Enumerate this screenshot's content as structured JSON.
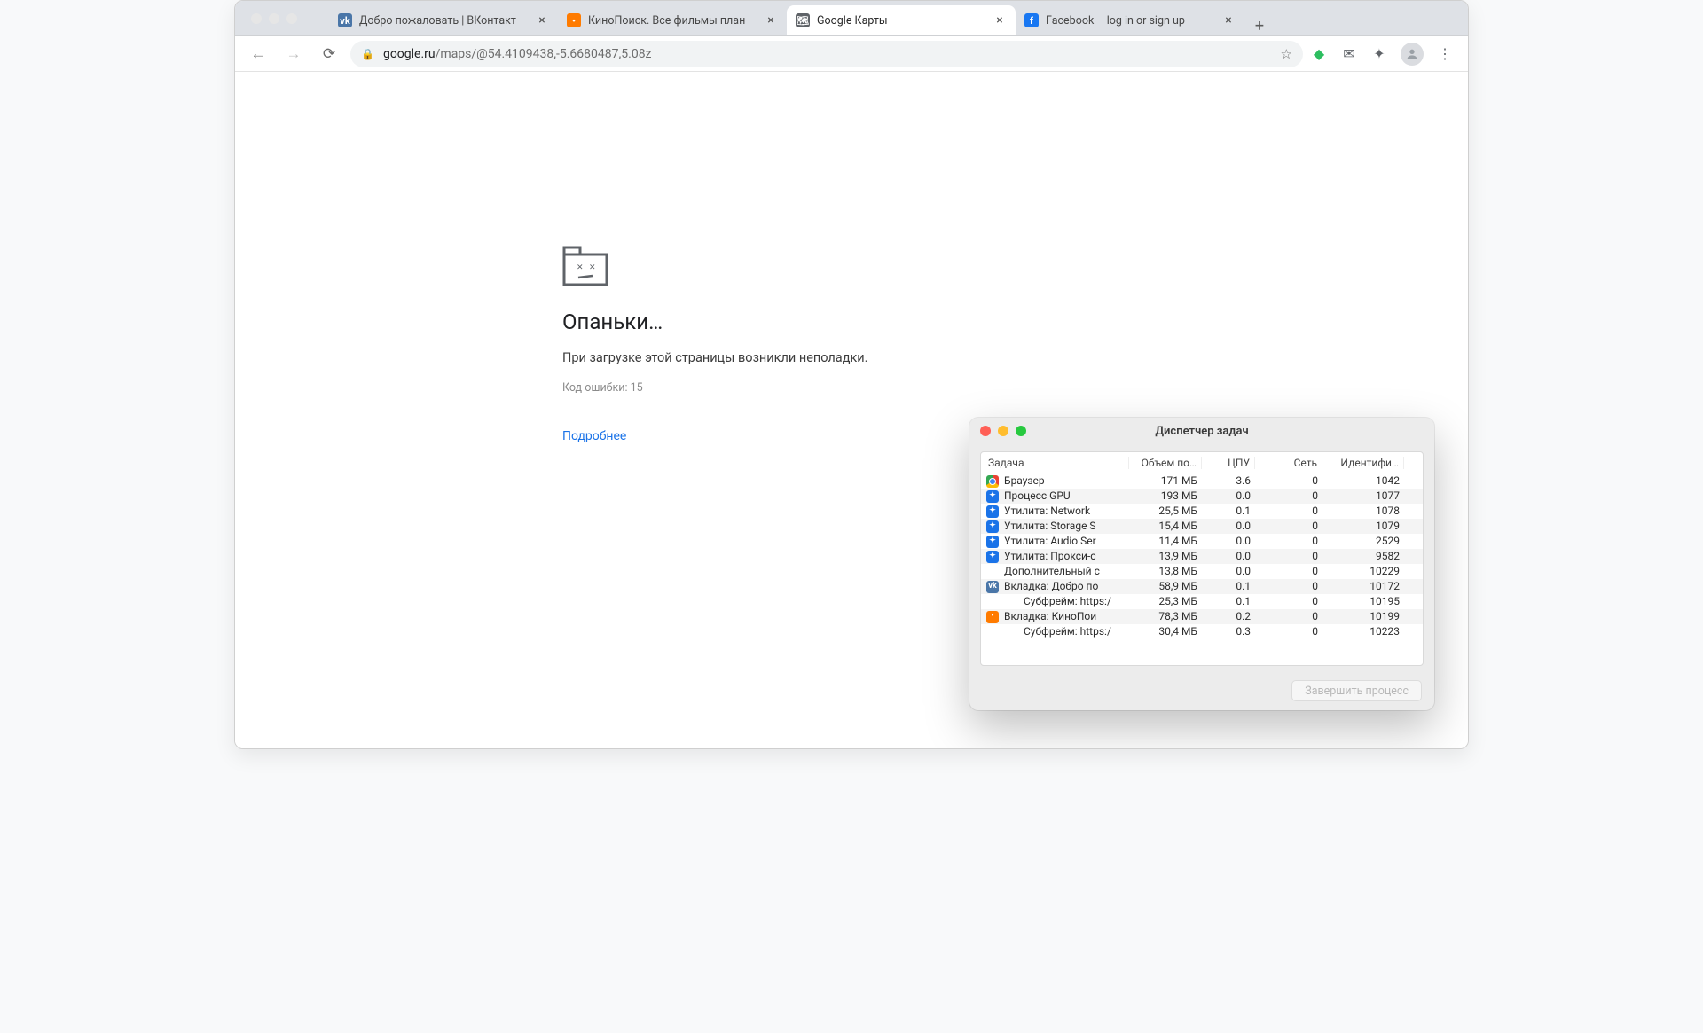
{
  "tabs": [
    {
      "title": "Добро пожаловать | ВКонтакт",
      "fav_bg": "#4a76a8",
      "fav_txt": "vk",
      "active": false
    },
    {
      "title": "КиноПоиск. Все фильмы план",
      "fav_bg": "#ff7b00",
      "fav_txt": "•",
      "active": false
    },
    {
      "title": "Google Карты",
      "fav_bg": "#5f6368",
      "fav_txt": "🗺",
      "active": true
    },
    {
      "title": "Facebook – log in or sign up",
      "fav_bg": "#1877f2",
      "fav_txt": "f",
      "active": false
    }
  ],
  "omnibox": {
    "host": "google.ru",
    "path": "/maps/@54.4109438,-5.6680487,5.08z"
  },
  "error": {
    "title": "Опаньки…",
    "subtitle": "При загрузке этой страницы возникли неполадки.",
    "code": "Код ошибки: 15",
    "link": "Подробнее"
  },
  "task_manager": {
    "title": "Диспетчер задач",
    "columns": {
      "task": "Задача",
      "mem": "Объем по…",
      "cpu": "ЦПУ",
      "net": "Сеть",
      "id": "Идентифи…"
    },
    "end_btn": "Завершить процесс",
    "rows": [
      {
        "fav_bg": "",
        "icon": "chrome",
        "name": "Браузер",
        "mem": "171 МБ",
        "cpu": "3.6",
        "net": "0",
        "id": "1042",
        "indent": false
      },
      {
        "fav_bg": "#1a73e8",
        "icon": "puzzle",
        "name": "Процесс GPU",
        "mem": "193 МБ",
        "cpu": "0.0",
        "net": "0",
        "id": "1077",
        "indent": false
      },
      {
        "fav_bg": "#1a73e8",
        "icon": "puzzle",
        "name": "Утилита: Network",
        "mem": "25,5 МБ",
        "cpu": "0.1",
        "net": "0",
        "id": "1078",
        "indent": false
      },
      {
        "fav_bg": "#1a73e8",
        "icon": "puzzle",
        "name": "Утилита: Storage S",
        "mem": "15,4 МБ",
        "cpu": "0.0",
        "net": "0",
        "id": "1079",
        "indent": false
      },
      {
        "fav_bg": "#1a73e8",
        "icon": "puzzle",
        "name": "Утилита: Audio Ser",
        "mem": "11,4 МБ",
        "cpu": "0.0",
        "net": "0",
        "id": "2529",
        "indent": false
      },
      {
        "fav_bg": "#1a73e8",
        "icon": "puzzle",
        "name": "Утилита: Прокси-с",
        "mem": "13,9 МБ",
        "cpu": "0.0",
        "net": "0",
        "id": "9582",
        "indent": false
      },
      {
        "fav_bg": "",
        "icon": "none",
        "name": "Дополнительный с",
        "mem": "13,8 МБ",
        "cpu": "0.0",
        "net": "0",
        "id": "10229",
        "indent": false
      },
      {
        "fav_bg": "#4a76a8",
        "icon": "vk",
        "name": "Вкладка: Добро по",
        "mem": "58,9 МБ",
        "cpu": "0.1",
        "net": "0",
        "id": "10172",
        "indent": false
      },
      {
        "fav_bg": "",
        "icon": "none",
        "name": "Субфрейм: https:/",
        "mem": "25,3 МБ",
        "cpu": "0.1",
        "net": "0",
        "id": "10195",
        "indent": true
      },
      {
        "fav_bg": "#ff7b00",
        "icon": "kp",
        "name": "Вкладка: КиноПои",
        "mem": "78,3 МБ",
        "cpu": "0.2",
        "net": "0",
        "id": "10199",
        "indent": false
      },
      {
        "fav_bg": "",
        "icon": "none",
        "name": "Субфрейм: https:/",
        "mem": "30,4 МБ",
        "cpu": "0.3",
        "net": "0",
        "id": "10223",
        "indent": true
      }
    ]
  }
}
